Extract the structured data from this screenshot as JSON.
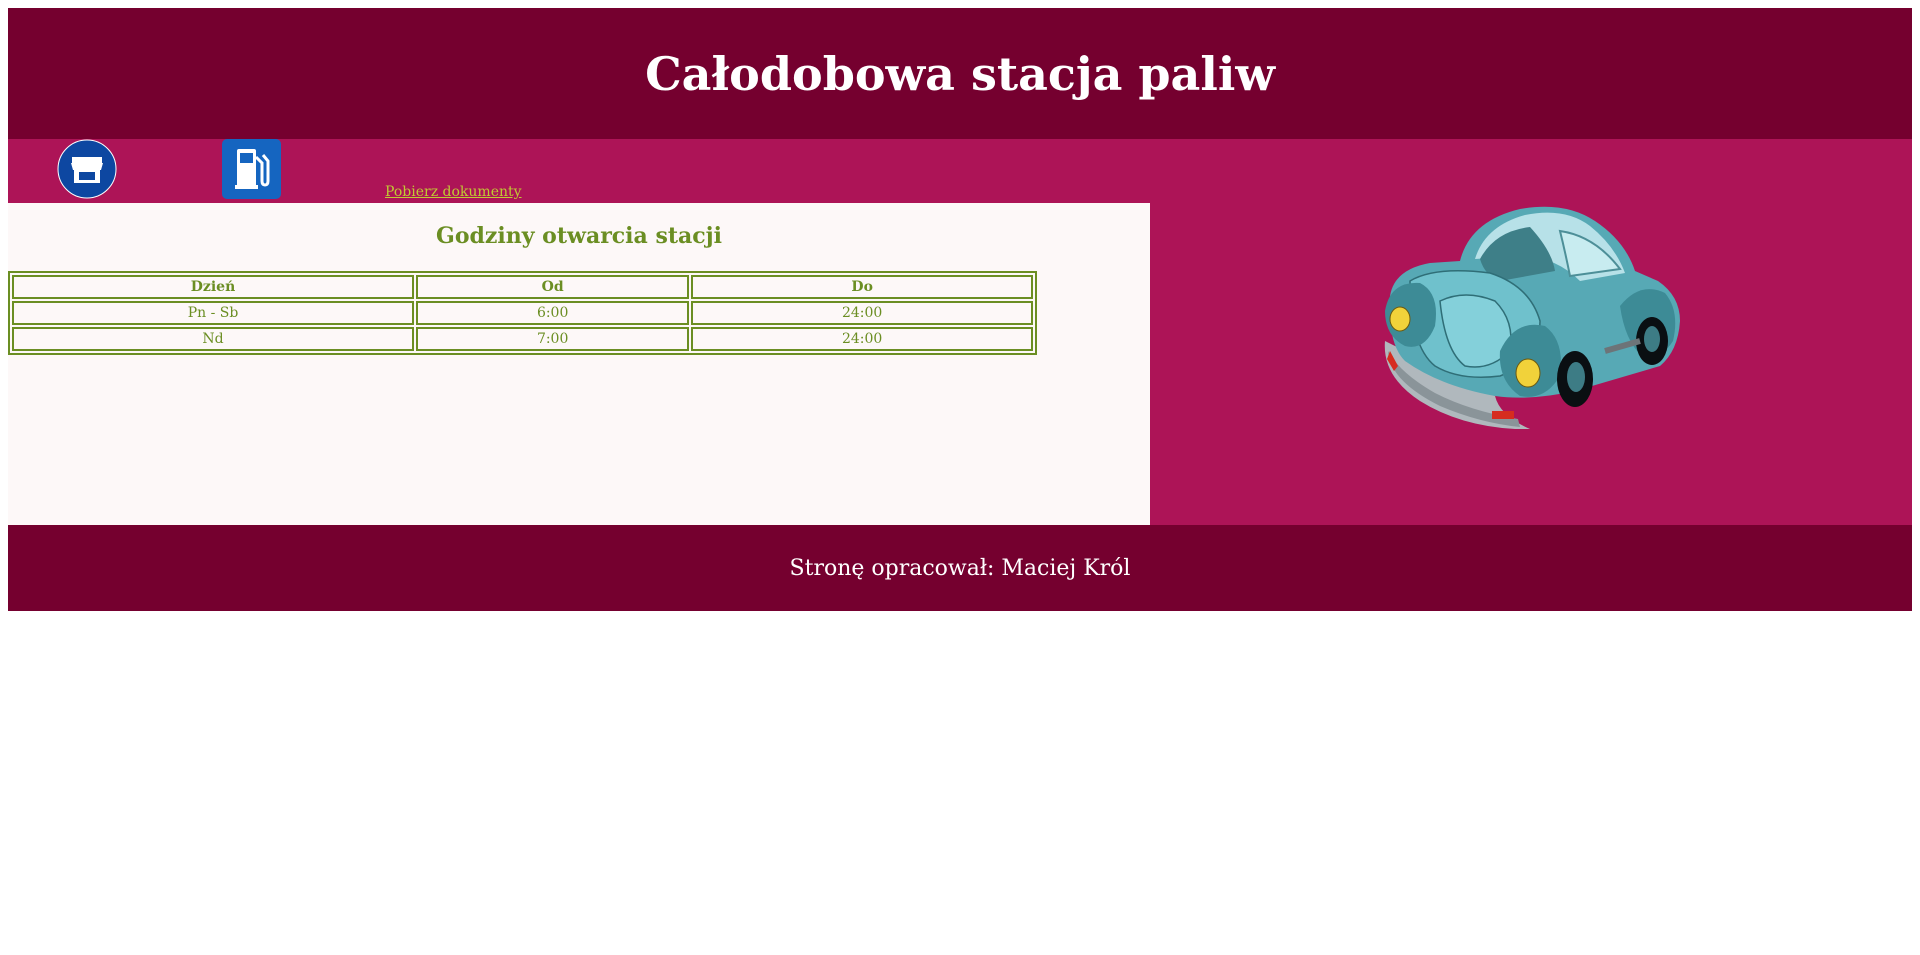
{
  "header": {
    "title": "Całodobowa stacja paliw"
  },
  "nav": {
    "items": [
      {
        "icon": "shop-icon",
        "color": "#0d47a1"
      },
      {
        "icon": "fuel-pump-icon",
        "color": "#1565c0"
      }
    ],
    "download_label": "Pobierz dokumenty"
  },
  "hours": {
    "title": "Godziny otwarcia stacji",
    "columns": [
      "Dzień",
      "Od",
      "Do"
    ],
    "rows": [
      [
        "Pn - Sb",
        "6:00",
        "24:00"
      ],
      [
        "Nd",
        "7:00",
        "24:00"
      ]
    ]
  },
  "aside": {
    "image": "car-illustration"
  },
  "footer": {
    "text": "Stronę opracował: Maciej Król"
  },
  "colors": {
    "header_bg": "#75002f",
    "nav_bg": "#ad1457",
    "content_bg": "#fdf8f8",
    "accent_green": "#6b8e23",
    "link_color": "#c0ca33"
  }
}
